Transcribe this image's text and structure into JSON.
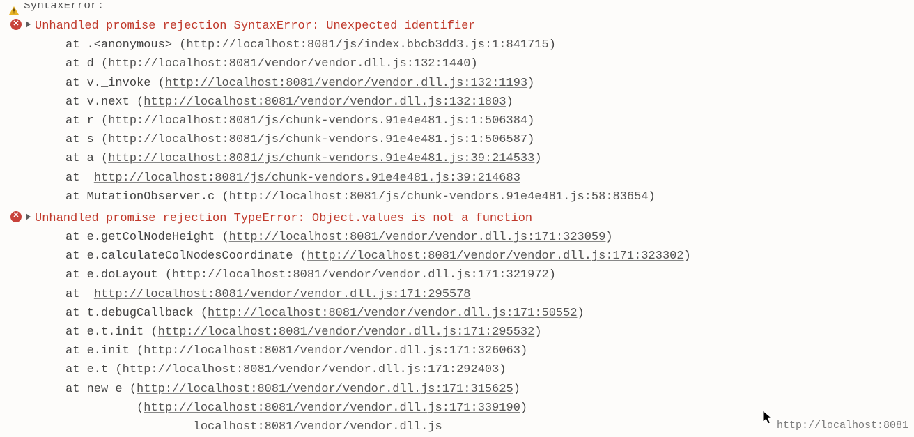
{
  "truncated_top": "SyntaxError:",
  "errors": [
    {
      "heading": "Unhandled promise rejection SyntaxError: Unexpected identifier",
      "frames": [
        {
          "context": "at .<anonymous> ",
          "loc": "http://localhost:8081/js/index.bbcb3dd3.js:1:841715",
          "wrap": true
        },
        {
          "context": "at d ",
          "loc": "http://localhost:8081/vendor/vendor.dll.js:132:1440",
          "wrap": true
        },
        {
          "context": "at v._invoke ",
          "loc": "http://localhost:8081/vendor/vendor.dll.js:132:1193",
          "wrap": true
        },
        {
          "context": "at v.next ",
          "loc": "http://localhost:8081/vendor/vendor.dll.js:132:1803",
          "wrap": true
        },
        {
          "context": "at r ",
          "loc": "http://localhost:8081/js/chunk-vendors.91e4e481.js:1:506384",
          "wrap": true
        },
        {
          "context": "at s ",
          "loc": "http://localhost:8081/js/chunk-vendors.91e4e481.js:1:506587",
          "wrap": true
        },
        {
          "context": "at a ",
          "loc": "http://localhost:8081/js/chunk-vendors.91e4e481.js:39:214533",
          "wrap": true
        },
        {
          "context": "at ",
          "loc": "http://localhost:8081/js/chunk-vendors.91e4e481.js:39:214683",
          "wrap": false
        },
        {
          "context": "at MutationObserver.c ",
          "loc": "http://localhost:8081/js/chunk-vendors.91e4e481.js:58:83654",
          "wrap": true
        }
      ]
    },
    {
      "heading": "Unhandled promise rejection TypeError: Object.values is not a function",
      "frames": [
        {
          "context": "at e.getColNodeHeight ",
          "loc": "http://localhost:8081/vendor/vendor.dll.js:171:323059",
          "wrap": true
        },
        {
          "context": "at e.calculateColNodesCoordinate ",
          "loc": "http://localhost:8081/vendor/vendor.dll.js:171:323302",
          "wrap": true
        },
        {
          "context": "at e.doLayout ",
          "loc": "http://localhost:8081/vendor/vendor.dll.js:171:321972",
          "wrap": true
        },
        {
          "context": "at ",
          "loc": "http://localhost:8081/vendor/vendor.dll.js:171:295578",
          "wrap": false
        },
        {
          "context": "at t.debugCallback ",
          "loc": "http://localhost:8081/vendor/vendor.dll.js:171:50552",
          "wrap": true
        },
        {
          "context": "at e.t.init ",
          "loc": "http://localhost:8081/vendor/vendor.dll.js:171:295532",
          "wrap": true
        },
        {
          "context": "at e.init ",
          "loc": "http://localhost:8081/vendor/vendor.dll.js:171:326063",
          "wrap": true
        },
        {
          "context": "at e.t ",
          "loc": "http://localhost:8081/vendor/vendor.dll.js:171:292403",
          "wrap": true
        },
        {
          "context": "at new e ",
          "loc": "http://localhost:8081/vendor/vendor.dll.js:171:315625",
          "wrap": true
        },
        {
          "context": "",
          "loc": "http://localhost:8081/vendor/vendor.dll.js:171:339190",
          "wrap": true,
          "paren_only_close": true,
          "partial_prefix": "          ("
        },
        {
          "context": "",
          "loc": "localhost:8081/vendor/vendor.dll.js",
          "wrap": false,
          "partial_prefix": "                  "
        }
      ]
    }
  ],
  "source_link": "http://localhost:8081"
}
